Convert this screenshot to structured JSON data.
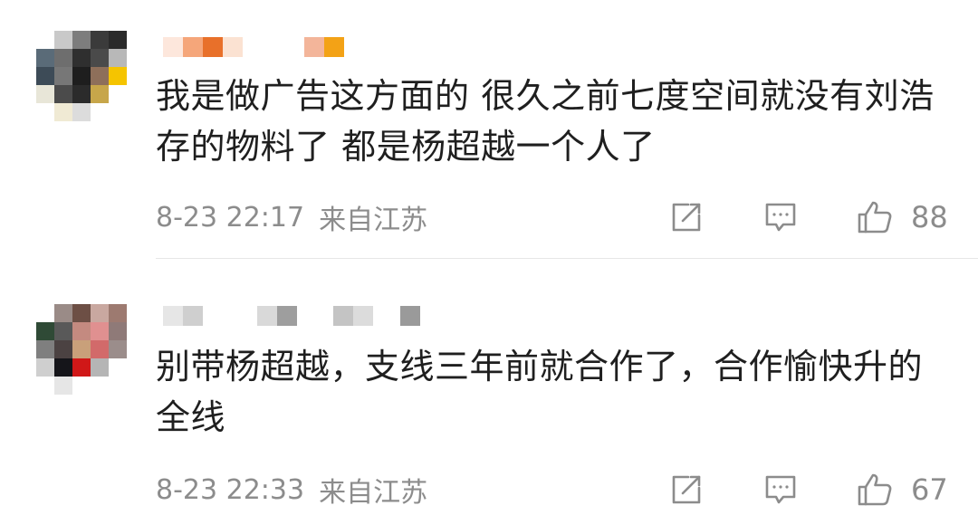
{
  "comments": [
    {
      "content": "我是做广告这方面的 很久之前七度空间就没有刘浩存的物料了 都是杨超越一个人了",
      "time": "8-23 22:17",
      "location": "来自江苏",
      "likes": "88"
    },
    {
      "content": "别带杨超越，支线三年前就合作了，合作愉快升的全线",
      "time": "8-23 22:33",
      "location": "来自江苏",
      "likes": "67"
    }
  ],
  "colors": {
    "meta_text": "#8c8c8c",
    "body_text": "#1f1f1f",
    "divider": "#e6e6e6"
  },
  "icons": [
    "repost-icon",
    "comment-icon",
    "like-icon"
  ]
}
